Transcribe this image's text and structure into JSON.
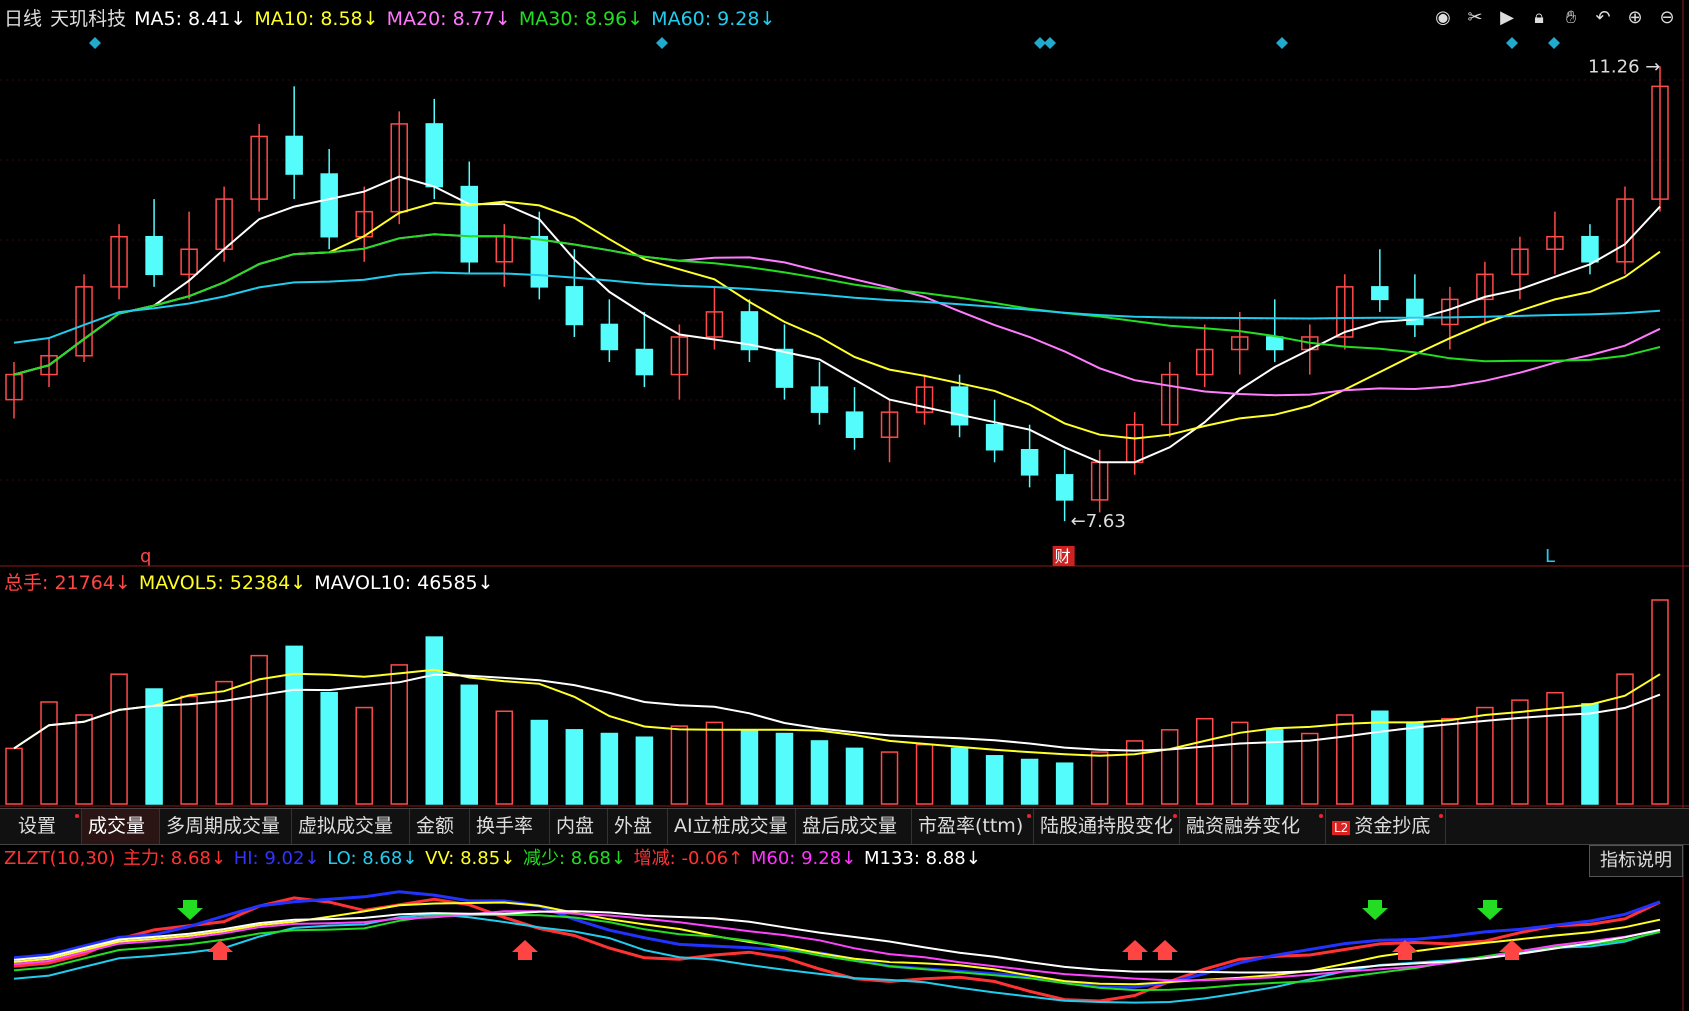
{
  "colors": {
    "up": "#ff4a4a",
    "down": "#54fcfc",
    "ma5": "#ffffff",
    "ma10": "#ffff2a",
    "ma20": "#ff7cff",
    "ma30": "#22dd22",
    "ma60": "#22ccee",
    "axis": "#8b1a1a"
  },
  "header": {
    "period": "日线",
    "name": "天玑科技",
    "ma5": "MA5: 8.41↓",
    "ma10": "MA10: 8.58↓",
    "ma20": "MA20: 8.77↓",
    "ma30": "MA30: 8.96↓",
    "ma60": "MA60: 9.28↓"
  },
  "toolbar_icons": [
    "eye-icon",
    "scissors-icon",
    "play-icon",
    "lock-icon",
    "hand-icon",
    "undo-icon",
    "zoom-in-icon",
    "zoom-out-icon"
  ],
  "price_annotations": {
    "high": "11.26",
    "low": "7.63",
    "event_q": "q",
    "event_cai": "财",
    "event_L": "L"
  },
  "volume_header": {
    "total": "总手: 21764↓",
    "mavol5": "MAVOL5: 52384↓",
    "mavol10": "MAVOL10: 46585↓"
  },
  "tabs": [
    "设置",
    "成交量",
    "多周期成交量",
    "虚拟成交量",
    "金额",
    "换手率",
    "内盘",
    "外盘",
    "AI立桩成交量",
    "盘后成交量",
    "市盈率(ttm)",
    "陆股通持股变化",
    "融资融券变化",
    "资金抄底"
  ],
  "tab_l2_badge": "L2",
  "indicator_header": {
    "name": "ZLZT(10,30)",
    "main": "主力: 8.68↓",
    "hi": "HI: 9.02↓",
    "lo": "LO: 8.68↓",
    "vv": "VV: 8.85↓",
    "dec": "减少: 8.68↓",
    "chg": "增减: -0.06↑",
    "m60": "M60: 9.28↓",
    "m133": "M133: 8.88↓"
  },
  "explain_button": "指标说明",
  "chart_data": {
    "type": "candlestick",
    "price_range": [
      7.63,
      11.26
    ],
    "candles": [
      [
        8.6,
        8.9,
        8.45,
        8.8
      ],
      [
        8.8,
        9.1,
        8.7,
        8.95
      ],
      [
        8.95,
        9.6,
        8.9,
        9.5
      ],
      [
        9.5,
        10.0,
        9.4,
        9.9
      ],
      [
        9.9,
        10.2,
        9.5,
        9.6
      ],
      [
        9.6,
        10.1,
        9.4,
        9.8
      ],
      [
        9.8,
        10.3,
        9.7,
        10.2
      ],
      [
        10.2,
        10.8,
        10.1,
        10.7
      ],
      [
        10.7,
        11.1,
        10.2,
        10.4
      ],
      [
        10.4,
        10.6,
        9.8,
        9.9
      ],
      [
        9.9,
        10.3,
        9.7,
        10.1
      ],
      [
        10.1,
        10.9,
        10.0,
        10.8
      ],
      [
        10.8,
        11.0,
        10.2,
        10.3
      ],
      [
        10.3,
        10.5,
        9.6,
        9.7
      ],
      [
        9.7,
        10.0,
        9.5,
        9.9
      ],
      [
        9.9,
        10.1,
        9.4,
        9.5
      ],
      [
        9.5,
        9.8,
        9.1,
        9.2
      ],
      [
        9.2,
        9.4,
        8.9,
        9.0
      ],
      [
        9.0,
        9.3,
        8.7,
        8.8
      ],
      [
        8.8,
        9.2,
        8.6,
        9.1
      ],
      [
        9.1,
        9.5,
        9.0,
        9.3
      ],
      [
        9.3,
        9.4,
        8.9,
        9.0
      ],
      [
        9.0,
        9.2,
        8.6,
        8.7
      ],
      [
        8.7,
        8.9,
        8.4,
        8.5
      ],
      [
        8.5,
        8.7,
        8.2,
        8.3
      ],
      [
        8.3,
        8.6,
        8.1,
        8.5
      ],
      [
        8.5,
        8.8,
        8.4,
        8.7
      ],
      [
        8.7,
        8.8,
        8.3,
        8.4
      ],
      [
        8.4,
        8.6,
        8.1,
        8.2
      ],
      [
        8.2,
        8.4,
        7.9,
        8.0
      ],
      [
        8.0,
        8.2,
        7.63,
        7.8
      ],
      [
        7.8,
        8.2,
        7.7,
        8.1
      ],
      [
        8.1,
        8.5,
        8.0,
        8.4
      ],
      [
        8.4,
        8.9,
        8.3,
        8.8
      ],
      [
        8.8,
        9.2,
        8.7,
        9.0
      ],
      [
        9.0,
        9.3,
        8.8,
        9.1
      ],
      [
        9.1,
        9.4,
        8.9,
        9.0
      ],
      [
        9.0,
        9.2,
        8.8,
        9.1
      ],
      [
        9.1,
        9.6,
        9.0,
        9.5
      ],
      [
        9.5,
        9.8,
        9.3,
        9.4
      ],
      [
        9.4,
        9.6,
        9.1,
        9.2
      ],
      [
        9.2,
        9.5,
        9.0,
        9.4
      ],
      [
        9.4,
        9.7,
        9.2,
        9.6
      ],
      [
        9.6,
        9.9,
        9.4,
        9.8
      ],
      [
        9.8,
        10.1,
        9.6,
        9.9
      ],
      [
        9.9,
        10.0,
        9.6,
        9.7
      ],
      [
        9.7,
        10.3,
        9.6,
        10.2
      ],
      [
        10.2,
        11.26,
        10.1,
        11.1
      ]
    ],
    "volume": [
      30,
      55,
      48,
      70,
      62,
      58,
      66,
      80,
      85,
      60,
      52,
      75,
      90,
      64,
      50,
      45,
      40,
      38,
      36,
      42,
      44,
      40,
      38,
      34,
      30,
      28,
      32,
      30,
      26,
      24,
      22,
      28,
      34,
      40,
      46,
      44,
      40,
      38,
      48,
      50,
      44,
      46,
      52,
      56,
      60,
      54,
      70,
      110
    ],
    "indicator_lines": [
      "主力",
      "HI",
      "LO",
      "VV",
      "减少",
      "M60",
      "M133"
    ]
  }
}
